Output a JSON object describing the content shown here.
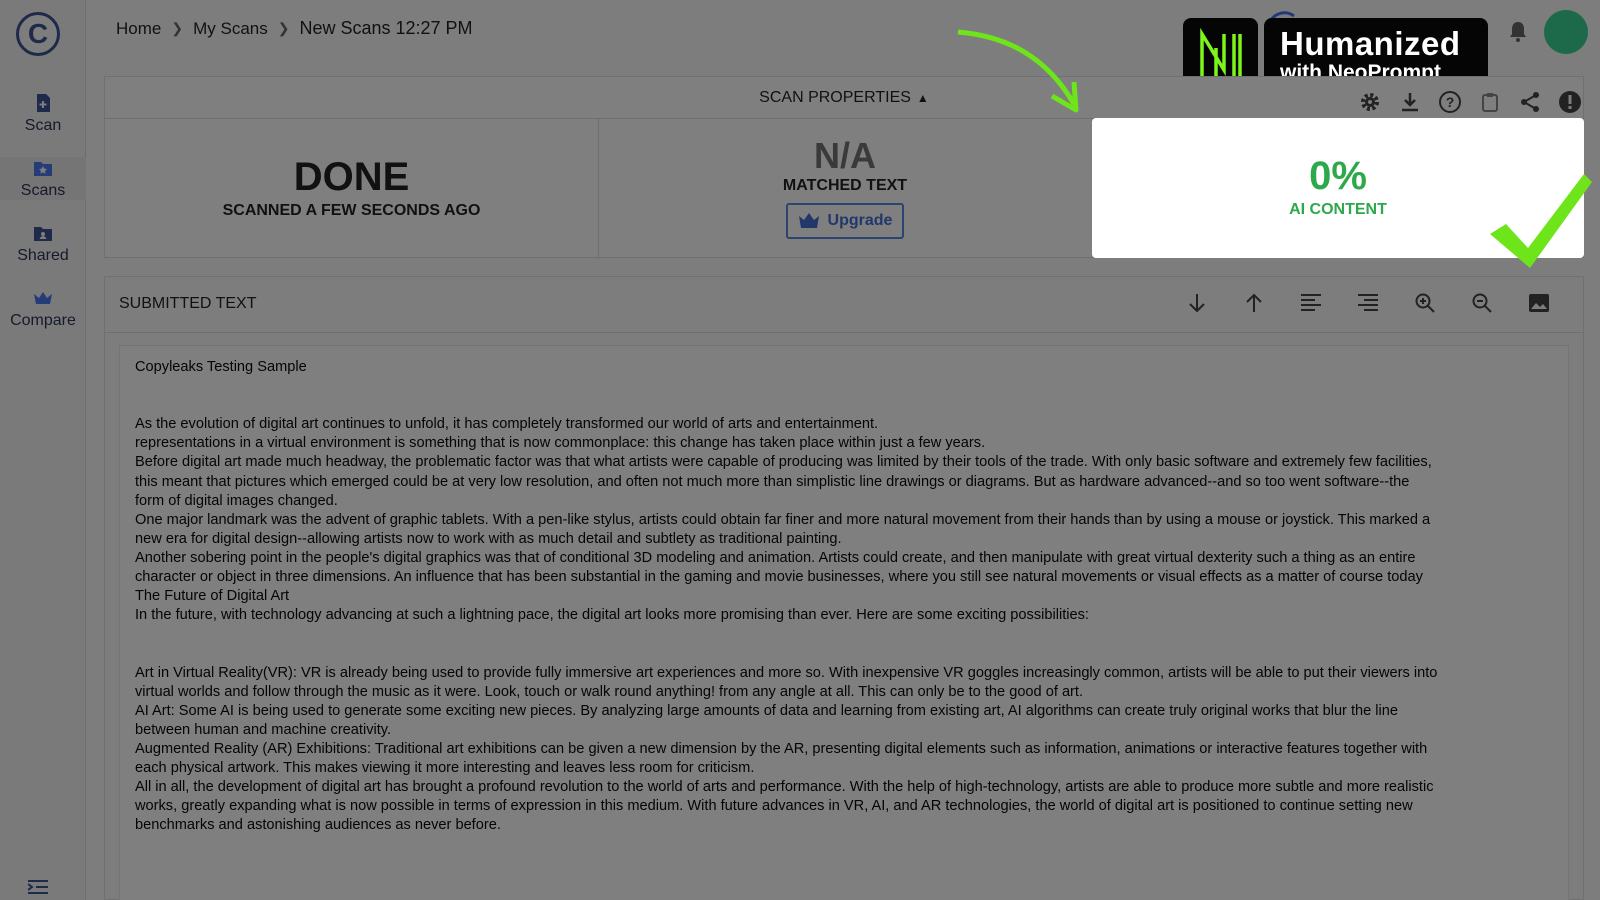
{
  "sidebar": {
    "logo": "C",
    "items": [
      {
        "label": "Scan",
        "icon": "document-plus-icon"
      },
      {
        "label": "Scans",
        "icon": "folder-star-icon"
      },
      {
        "label": "Shared",
        "icon": "shared-folder-icon"
      },
      {
        "label": "Compare",
        "icon": "crown-icon"
      }
    ]
  },
  "breadcrumb": {
    "items": [
      "Home",
      "My Scans"
    ],
    "current": "New Scans 12:27 PM"
  },
  "badge": {
    "title": "Humanized",
    "subtitle": "with NeoPrompt",
    "accent": "#7cf51a"
  },
  "scan_properties": {
    "header": "SCAN PROPERTIES",
    "status": "DONE",
    "status_sub": "SCANNED A FEW SECONDS AGO",
    "matched_value": "N/A",
    "matched_label": "MATCHED TEXT",
    "upgrade_label": "Upgrade",
    "ai_value": "0%",
    "ai_label": "AI CONTENT",
    "ai_color": "#2da84a",
    "actions": [
      "gear-icon",
      "download-icon",
      "help-icon",
      "clipboard-icon",
      "share-icon",
      "alert-icon"
    ]
  },
  "submitted": {
    "title": "SUBMITTED TEXT",
    "toolbar": [
      "arrow-down-icon",
      "arrow-up-icon",
      "align-left-icon",
      "align-right-icon",
      "zoom-in-icon",
      "zoom-out-icon",
      "image-icon"
    ],
    "heading": "Copyleaks Testing Sample",
    "para1": [
      "As the evolution of digital art continues to unfold, it has completely transformed our world of arts and entertainment.",
      "representations in a virtual environment is something that is now commonplace: this change has taken place within just a few years.",
      "Before digital art made much headway, the problematic factor was that what artists were capable of producing was limited by their tools of the trade. With only basic software and extremely few facilities,",
      "this meant that pictures which emerged could be at very low resolution, and often not much more than simplistic line drawings or diagrams. But as hardware advanced--and so too went software--the",
      "form of digital images changed.",
      "One major landmark was the advent of graphic tablets. With a pen-like stylus, artists could obtain far finer and more natural movement from their hands than by using a mouse or joystick. This marked a",
      "new era for digital design--allowing artists now to work with as much detail and subtlety as traditional painting.",
      "Another sobering point in the people's digital graphics was that of conditional 3D modeling and animation. Artists could create, and then manipulate with great virtual dexterity such a thing as an entire",
      "character or object in three dimensions. An influence that has been substantial in the gaming and movie businesses, where you still see natural movements or visual effects as a matter of course today",
      "The Future of Digital Art",
      "In the future, with technology advancing at such a lightning pace, the digital art looks more promising than ever. Here are some exciting possibilities:"
    ],
    "para2": [
      "Art in Virtual Reality(VR): VR is already being used to provide fully immersive art experiences and more so. With inexpensive VR goggles increasingly common, artists will be able to put their viewers into",
      "virtual worlds and follow through the music as it were. Look, touch or walk round anything! from any angle at all. This can only be to the good of art.",
      "AI Art: Some AI is being used to generate some exciting new pieces. By analyzing large amounts of data and learning from existing art, AI algorithms can create truly original works that blur the line",
      "between human and machine creativity.",
      "Augmented Reality (AR) Exhibitions: Traditional art exhibitions can be given a new dimension by the AR, presenting digital elements such as information, animations or interactive features together with",
      "each physical artwork. This makes viewing it more interesting and leaves less room for criticism.",
      "All in all, the development of digital art has brought a profound revolution to the world of arts and performance. With the help of high-technology, artists are able to produce more subtle and more realistic",
      "works, greatly expanding what is now possible in terms of expression in this medium. With future advances in VR, AI, and AR technologies, the world of digital art is positioned to continue setting new",
      "benchmarks and astonishing audiences as never before."
    ]
  }
}
